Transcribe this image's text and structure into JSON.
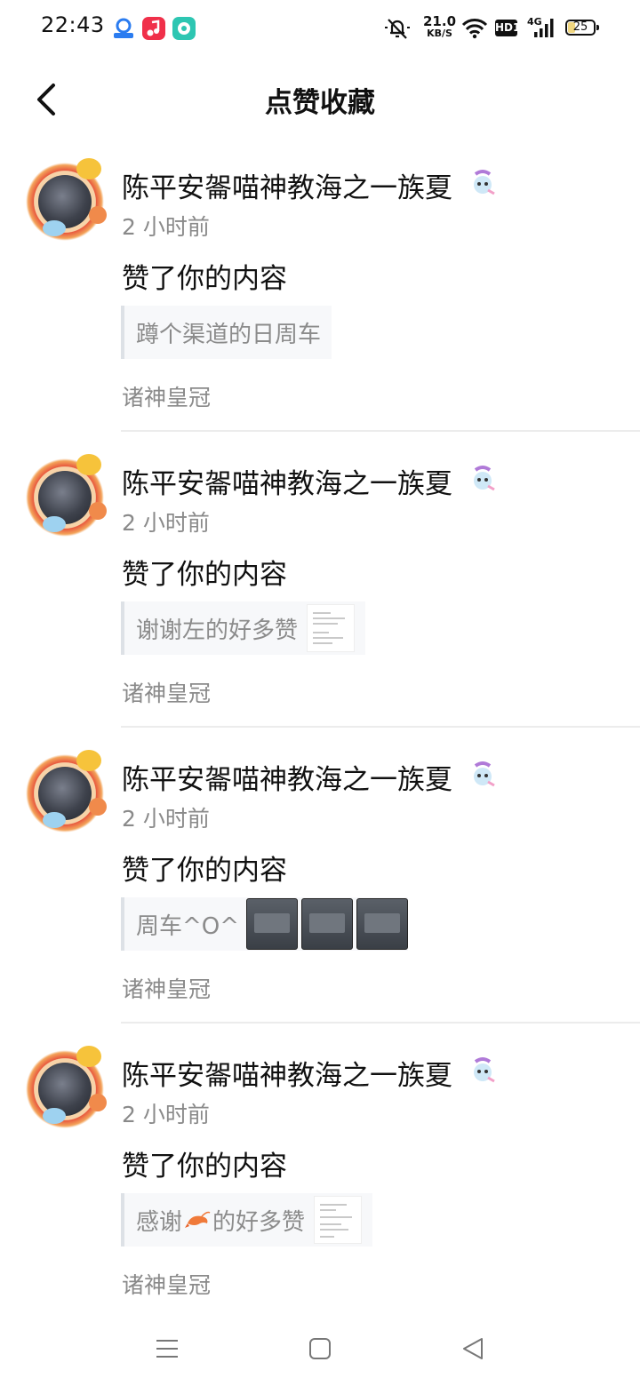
{
  "status_bar": {
    "time": "22:43",
    "net_speed_value": "21.0",
    "net_speed_unit": "KB/S",
    "hd_label": "HD1",
    "network_label": "4G",
    "battery": "25",
    "app_icons": [
      "app-icon-blue",
      "music-icon",
      "app-icon-teal"
    ]
  },
  "header": {
    "title": "点赞收藏",
    "back_icon": "chevron-left-icon"
  },
  "colors": {
    "text_primary": "#111111",
    "text_secondary": "#8a8a8a",
    "quote_bg": "#f7f8fa",
    "quote_border": "#dde1e6"
  },
  "items": [
    {
      "name": "陈平安嗧喵神教海之一族夏",
      "badge_icon": "unicorn-cat-icon",
      "time": "2 小时前",
      "action": "赞了你的内容",
      "quote": "蹲个渠道的日周车",
      "thumbnails": "none",
      "group": "诸神皇冠"
    },
    {
      "name": "陈平安嗧喵神教海之一族夏",
      "badge_icon": "unicorn-cat-icon",
      "time": "2 小时前",
      "action": "赞了你的内容",
      "quote": "谢谢左的好多赞",
      "thumbnails": "document",
      "group": "诸神皇冠"
    },
    {
      "name": "陈平安嗧喵神教海之一族夏",
      "badge_icon": "unicorn-cat-icon",
      "time": "2 小时前",
      "action": "赞了你的内容",
      "quote": "周车^O^",
      "thumbnails": "game-screenshots",
      "group": "诸神皇冠"
    },
    {
      "name": "陈平安嗧喵神教海之一族夏",
      "badge_icon": "unicorn-cat-icon",
      "time": "2 小时前",
      "action": "赞了你的内容",
      "quote_before": "感谢",
      "quote_emoji": "shrimp-emoji-icon",
      "quote_after": "的好多赞",
      "thumbnails": "document",
      "group": "诸神皇冠"
    }
  ],
  "nav_bar": {
    "menu_icon": "menu-icon",
    "home_icon": "home-square-icon",
    "back_icon": "back-triangle-icon"
  }
}
